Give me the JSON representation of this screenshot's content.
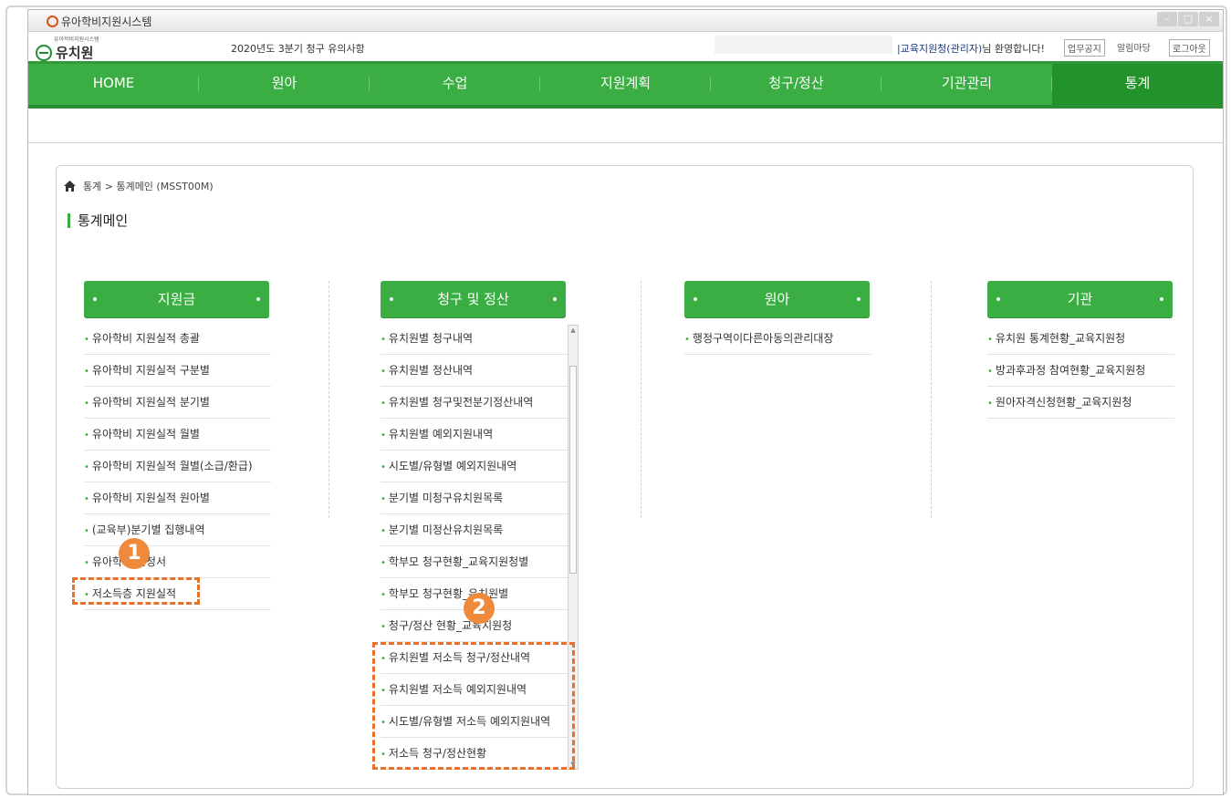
{
  "titlebar": {
    "title": "유아학비지원시스템"
  },
  "header": {
    "brand_small": "유아학비지원시스템",
    "brand_name": "유치원",
    "notice": "2020년도 3분기 청구 유의사항",
    "welcome_who": "|교육지원청(관리자)",
    "welcome_rest": "님 환영합니다!",
    "btn_notice": "업무공지",
    "btn_alarm": "알림마당",
    "btn_logout": "로그아웃"
  },
  "nav": {
    "items": [
      "HOME",
      "원아",
      "수업",
      "지원계획",
      "청구/정산",
      "기관관리",
      "통계"
    ],
    "active": "통계"
  },
  "breadcrumb": "통계 > 통계메인 (MSST00M)",
  "page_title": "통계메인",
  "columns": [
    {
      "title": "지원금",
      "items": [
        "유아학비 지원실적 총괄",
        "유아학비 지원실적 구분별",
        "유아학비 지원실적 분기별",
        "유아학비 지원실적 월별",
        "유아학비 지원실적 월별(소급/환급)",
        "유아학비 지원실적 원아별",
        "(교육부)분기별 집행내역",
        "유아학비 신청서",
        "저소득층 지원실적"
      ]
    },
    {
      "title": "청구 및 정산",
      "items": [
        "유치원별 청구내역",
        "유치원별 정산내역",
        "유치원별 청구및전분기정산내역",
        "유치원별 예외지원내역",
        "시도별/유형별 예외지원내역",
        "분기별 미청구유치원목록",
        "분기별 미정산유치원목록",
        "학부모 청구현황_교육지원청별",
        "학부모 청구현황_유치원별",
        "청구/정산 현황_교육지원청",
        "유치원별 저소득 청구/정산내역",
        "유치원별 저소득 예외지원내역",
        "시도별/유형별 저소득 예외지원내역",
        "저소득 청구/정산현황"
      ]
    },
    {
      "title": "원아",
      "items": [
        "행정구역이다른아동의관리대장"
      ]
    },
    {
      "title": "기관",
      "items": [
        "유치원 통계현황_교육지원청",
        "방과후과정 참여현황_교육지원청",
        "원아자격신청현황_교육지원청"
      ]
    }
  ],
  "badges": [
    "1",
    "2"
  ],
  "colors": {
    "nav_green": "#3aad43",
    "highlight_orange": "#e8702a"
  }
}
